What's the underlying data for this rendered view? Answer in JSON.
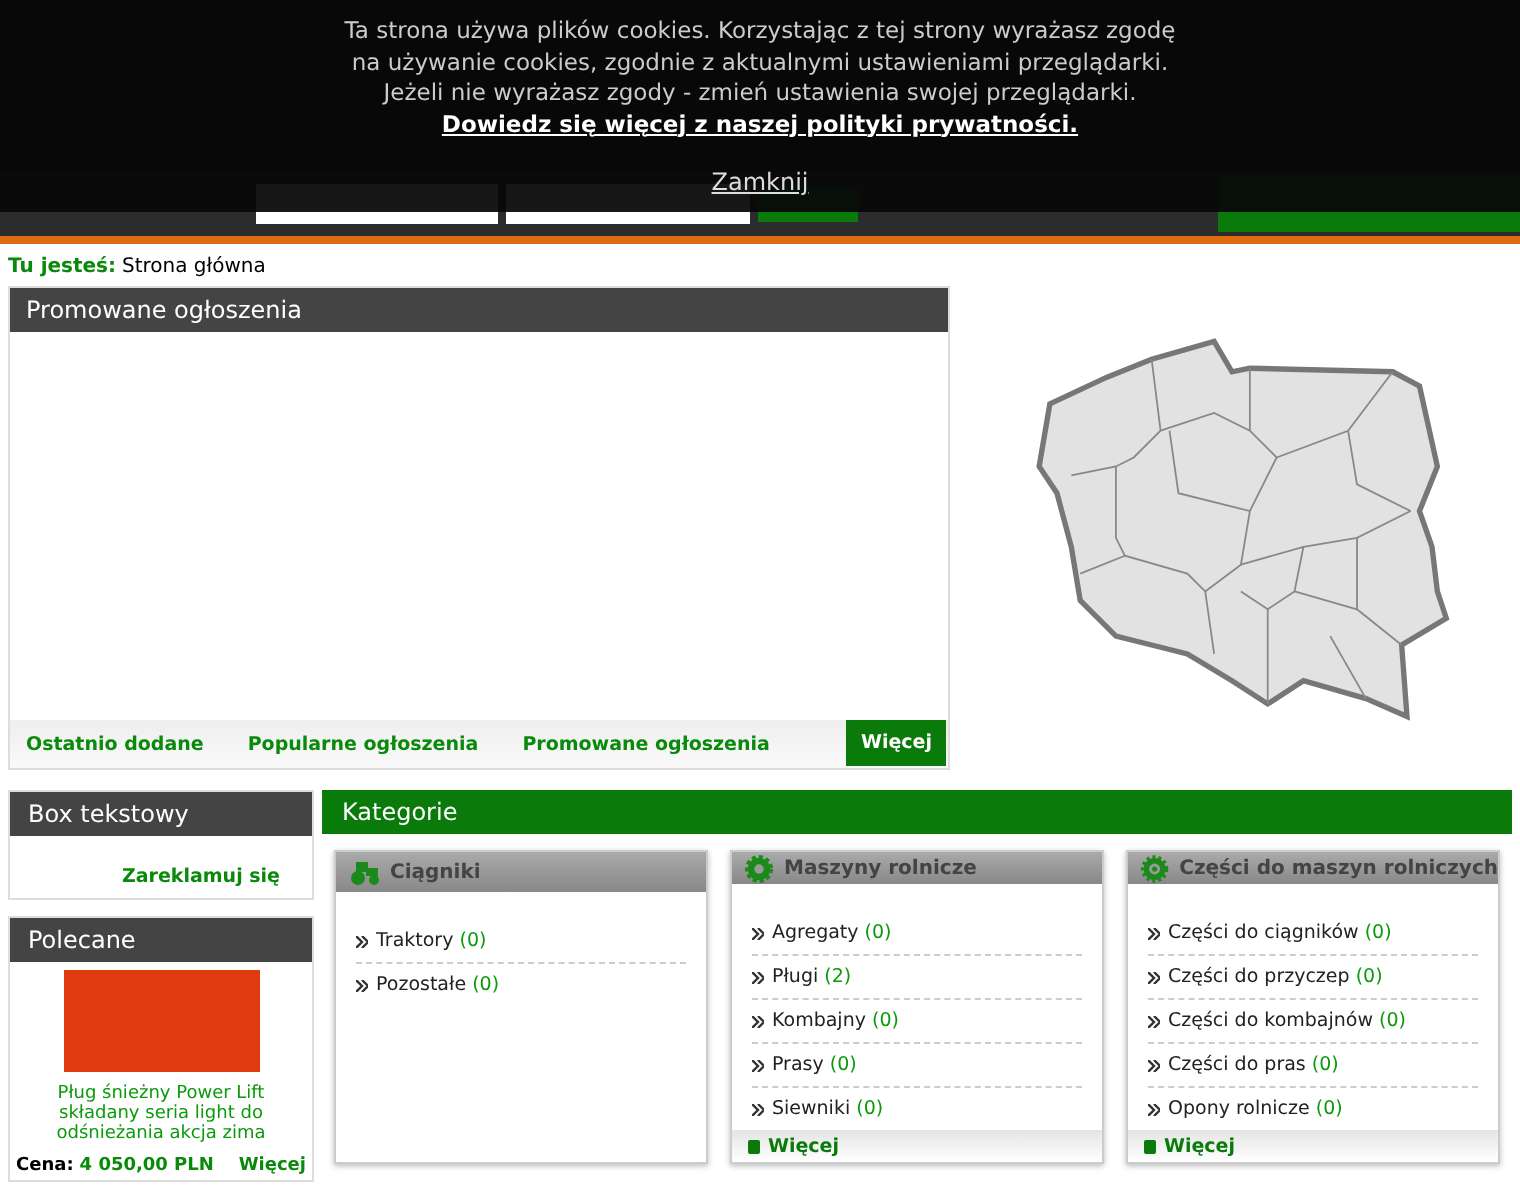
{
  "cookie_banner": {
    "message_lines": [
      "Ta strona używa plików cookies. Korzystając z tej strony wyrażasz zgodę",
      "na używanie cookies, zgodnie z aktualnymi ustawieniami przeglądarki.",
      "Jeżeli nie wyrażasz zgody - zmień ustawienia swojej przeglądarki."
    ],
    "policy_link": "Dowiedz się więcej z naszej polityki prywatności.",
    "close_link": "Zamknij"
  },
  "breadcrumb": {
    "label": "Tu jesteś:",
    "current": "Strona główna"
  },
  "promoted": {
    "title": "Promowane ogłoszenia",
    "tabs": [
      "Ostatnio dodane",
      "Popularne ogłoszenia",
      "Promowane ogłoszenia"
    ],
    "more_button": "Więcej"
  },
  "text_box": {
    "title": "Box tekstowy",
    "link": "Zareklamuj się"
  },
  "recommended": {
    "title": "Polecane",
    "item_title": "Pług śnieżny Power Lift składany seria light do odśnieżania akcja zima",
    "price_label": "Cena:",
    "price": "4 050,00 PLN",
    "more_link": "Więcej"
  },
  "categories": {
    "title": "Kategorie",
    "groups": [
      {
        "title": "Ciągniki",
        "kind": "tractor",
        "items": [
          {
            "name": "Traktory",
            "count": "(0)"
          },
          {
            "name": "Pozostałe",
            "count": "(0)"
          }
        ]
      },
      {
        "title": "Maszyny rolnicze",
        "kind": "gear",
        "items": [
          {
            "name": "Agregaty",
            "count": "(0)"
          },
          {
            "name": "Pługi",
            "count": "(2)"
          },
          {
            "name": "Kombajny",
            "count": "(0)"
          },
          {
            "name": "Prasy",
            "count": "(0)"
          },
          {
            "name": "Siewniki",
            "count": "(0)"
          }
        ],
        "more_link": "Więcej"
      },
      {
        "title": "Części do maszyn rolniczych",
        "kind": "cog",
        "items": [
          {
            "name": "Części do ciągników",
            "count": "(0)"
          },
          {
            "name": "Części do przyczep",
            "count": "(0)"
          },
          {
            "name": "Części do kombajnów",
            "count": "(0)"
          },
          {
            "name": "Części do pras",
            "count": "(0)"
          },
          {
            "name": "Opony rolnicze",
            "count": "(0)"
          }
        ],
        "more_link": "Więcej"
      }
    ]
  }
}
